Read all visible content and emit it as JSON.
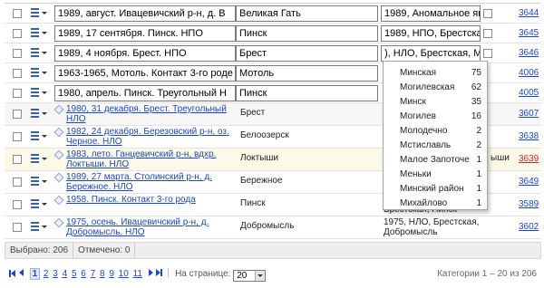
{
  "edit_rows": [
    {
      "title": "1989, август. Ивацевичский р-н, д. В",
      "place": "Великая Гать",
      "desc": "1989, Аномальное явл",
      "num": "3644"
    },
    {
      "title": "1989, 17 сентября. Пинск. НПО",
      "place": "Пинск",
      "desc": "1989, НПО, Брестская,",
      "num": "3645"
    },
    {
      "title": "1989, 4 ноября. Брест. НПО",
      "place": "Брест",
      "desc": "), НЛО, Брестская, М",
      "num": "3646"
    },
    {
      "title": "1963-1965, Мотоль. Контакт 3-го роде",
      "place": "Мотоль",
      "desc": "",
      "num": "4006"
    },
    {
      "title": "1980, апрель. Пинск. Треугольный Н",
      "place": "Пинск",
      "desc": "",
      "num": "4005"
    }
  ],
  "view_rows": [
    {
      "title": "1980, 31 декабря. Брест. Треугольный НЛО",
      "place": "Брест",
      "desc": "",
      "desc_right": "",
      "num": "3607",
      "red": false
    },
    {
      "title": "1982, 24 декабря. Березовский р-н, оз. Черное. НЛО",
      "place": "Белоозерск",
      "desc": "",
      "desc_right": "",
      "num": "3638",
      "red": false
    },
    {
      "title": "1983, лето. Ганцевичский р-н, вдхр. Локтыши. НЛО",
      "place": "Локтыши",
      "desc": "",
      "desc_right": "ыши",
      "num": "3639",
      "red": true
    },
    {
      "title": "1989, 27 марта. Столинский р-н, д. Бережное. НЛО",
      "place": "Бережное",
      "desc": "",
      "desc_right": "",
      "num": "3649",
      "red": false
    },
    {
      "title": "1958. Пинск. Контакт 3-го рода",
      "place": "Пинск",
      "desc": "Брестская, Пинск",
      "desc_right": "",
      "num": "3589",
      "red": false
    },
    {
      "title": "1975, осень. Ивацевичский р-н, д. Добромысль. НЛО",
      "place": "Добромысль",
      "desc": "1975, НЛО, Брестская, Добромысль",
      "desc_right": "",
      "num": "3602",
      "red": false
    }
  ],
  "status": {
    "selected": "Выбрано: 206",
    "marked": "Отмечено: 0"
  },
  "pager": {
    "pages": [
      "1",
      "2",
      "3",
      "4",
      "5",
      "6",
      "7",
      "8",
      "9",
      "10",
      "11"
    ],
    "current": "1",
    "per_page_label": "На странице:",
    "per_page_value": "20",
    "range": "Категории 1 – 20 из 206"
  },
  "autocomplete": [
    {
      "name": "Минская",
      "count": "75"
    },
    {
      "name": "Могилевская",
      "count": "62"
    },
    {
      "name": "Минск",
      "count": "35"
    },
    {
      "name": "Могилев",
      "count": "16"
    },
    {
      "name": "Молодечно",
      "count": "2"
    },
    {
      "name": "Мстиславль",
      "count": "2"
    },
    {
      "name": "Малое Запоточе",
      "count": "1"
    },
    {
      "name": "Меньки",
      "count": "1"
    },
    {
      "name": "Минский район",
      "count": "1"
    },
    {
      "name": "Михайлово",
      "count": "1"
    }
  ],
  "colors": {
    "link": "#1c48b8",
    "alert": "#d8202a",
    "highlight_row": "#fcf9e8"
  }
}
